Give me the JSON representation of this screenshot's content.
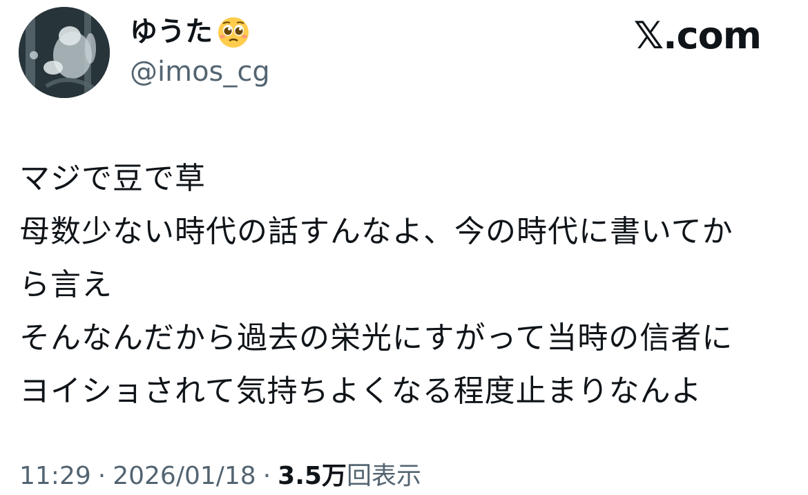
{
  "author": {
    "display_name": "ゆうた",
    "name_emoji": "pleading-face-emoji",
    "handle": "@imos_cg",
    "avatar": "avatar-image"
  },
  "site": {
    "logo_text": "𝕏.com"
  },
  "tweet": {
    "lines": [
      "マジで豆で草",
      "母数少ない時代の話すんなよ、今の時代に書いてか",
      "ら言え",
      "そんなんだから過去の栄光にすがって当時の信者に",
      "ヨイショされて気持ちよくなる程度止まりなんよ"
    ]
  },
  "meta": {
    "time": "11:29",
    "separator": "·",
    "date": "2026/01/18",
    "views_count": "3.5万",
    "views_label": "回表示"
  }
}
